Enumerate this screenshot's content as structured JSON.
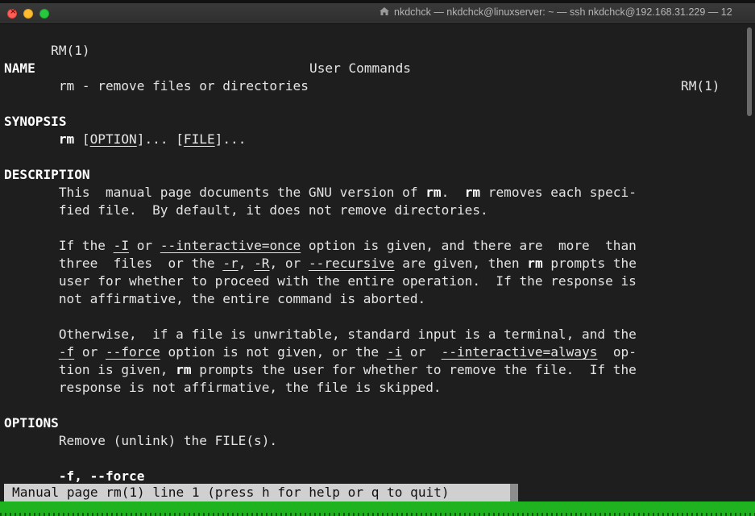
{
  "window": {
    "title": "nkdchck — nkdchck@linuxserver: ~ — ssh nkdchck@192.168.31.229 — 12",
    "icon": "home-folder-icon"
  },
  "man": {
    "header_left": "RM(1)",
    "header_center": "User Commands",
    "header_right": "RM(1)",
    "name_heading": "NAME",
    "name_text": "       rm - remove files or directories",
    "synopsis_heading": "SYNOPSIS",
    "synopsis": {
      "indent": "       ",
      "cmd": "rm",
      "open1": " [",
      "option": "OPTION",
      "mid": "]... [",
      "file": "FILE",
      "close": "]..."
    },
    "description_heading": "DESCRIPTION",
    "desc1": {
      "a": "       This  manual page documents the GNU version of ",
      "rm1": "rm",
      "b": ".  ",
      "rm2": "rm",
      "c": " removes each speci-"
    },
    "desc2": "       fied file.  By default, it does not remove directories.",
    "desc3": {
      "a": "       If the ",
      "opt_I": "-I",
      "b": " or ",
      "opt_interactive_once": "--interactive=once",
      "c": " option is given, and there are  more  than"
    },
    "desc4": {
      "a": "       three  files  or the ",
      "opt_r": "-r",
      "b": ", ",
      "opt_R": "-R",
      "c": ", or ",
      "opt_recursive": "--recursive",
      "d": " are given, then ",
      "rm": "rm",
      "e": " prompts the"
    },
    "desc5": "       user for whether to proceed with the entire operation.  If the response is",
    "desc6": "       not affirmative, the entire command is aborted.",
    "desc7": "       Otherwise,  if a file is unwritable, standard input is a terminal, and the",
    "desc8": {
      "a": "       ",
      "opt_f": "-f",
      "b": " or ",
      "opt_force": "--force",
      "c": " option is not given, or the ",
      "opt_i": "-i",
      "d": " or  ",
      "opt_interactive_always": "--interactive=always",
      "e": "  op-"
    },
    "desc9": {
      "a": "       tion is given, ",
      "rm": "rm",
      "b": " prompts the user for whether to remove the file.  If the"
    },
    "desc10": "       response is not affirmative, the file is skipped.",
    "options_heading": "OPTIONS",
    "options_text": "       Remove (unlink) the FILE(s).",
    "force_indent": "       ",
    "force_option": "-f, --force"
  },
  "status_line": "Manual page rm(1) line 1 (press h for help or q to quit)",
  "colors": {
    "background": "#1e1e1e",
    "text": "#e4e4e4",
    "status_bg": "#d0d0d0",
    "bottom_bar": "#1fb31f"
  }
}
